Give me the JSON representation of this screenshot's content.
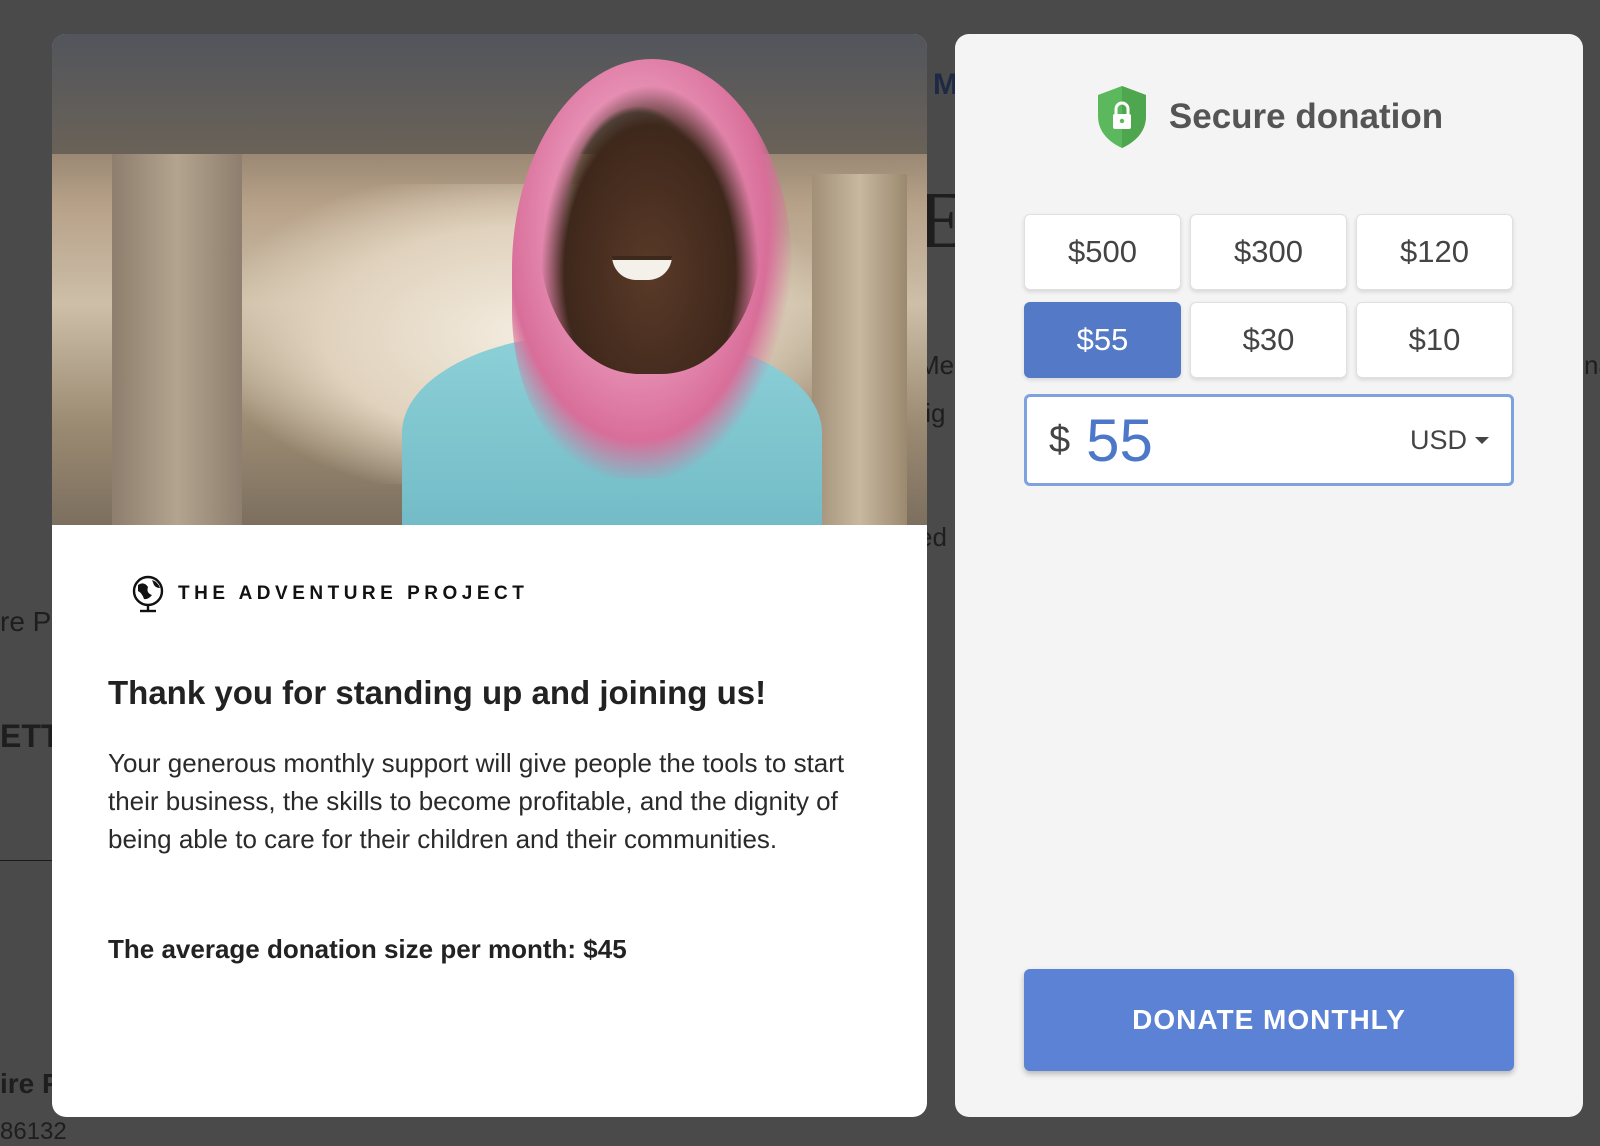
{
  "background_page": {
    "fragment_1": "M",
    "fragment_2": "E",
    "fragment_3": "Me",
    "fragment_4": "fig",
    "fragment_5": "ed",
    "fragment_6": "na",
    "fragment_7": "re Pr",
    "fragment_8": "ETT",
    "fragment_9": "ire P",
    "fragment_10": "86132"
  },
  "left_card": {
    "image_alt": "Smiling woman wearing a pink headscarf and light blue shirt",
    "brand": {
      "icon": "globe-icon",
      "name": "THE ADVENTURE PROJECT"
    },
    "title": "Thank you for standing up and joining us!",
    "body": "Your generous monthly support will give people the tools to start their business, the skills to become profitable, and the dignity of being able to care for their children and their communities.",
    "average": "The average donation size per month: $45"
  },
  "right_card": {
    "header": {
      "icon": "shield-lock-icon",
      "title": "Secure donation"
    },
    "amounts": [
      {
        "label": "$500",
        "selected": false
      },
      {
        "label": "$300",
        "selected": false
      },
      {
        "label": "$120",
        "selected": false
      },
      {
        "label": "$55",
        "selected": true
      },
      {
        "label": "$30",
        "selected": false
      },
      {
        "label": "$10",
        "selected": false
      }
    ],
    "input": {
      "currency_symbol": "$",
      "value": "55",
      "currency": "USD"
    },
    "donate_label": "DONATE MONTHLY"
  },
  "colors": {
    "accent": "#5479c7",
    "donate_button": "#5b82d4",
    "shield": "#5cb85c",
    "input_border": "#7ea1df"
  }
}
